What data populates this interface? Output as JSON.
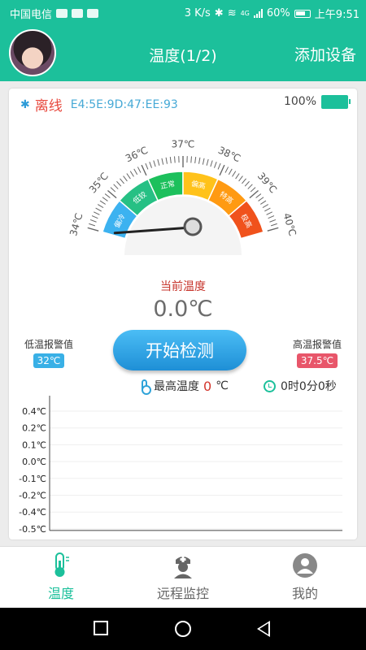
{
  "status_bar": {
    "carrier": "中国电信",
    "speed": "3 K/s",
    "network": "4G",
    "battery": "60%",
    "time": "上午9:51"
  },
  "header": {
    "title": "温度(1/2)",
    "add_device": "添加设备"
  },
  "device": {
    "status": "离线",
    "mac": "E4:5E:9D:47:EE:93",
    "battery_pct": "100%",
    "battery_level": 1.0
  },
  "gauge": {
    "ticks": [
      "34℃",
      "35℃",
      "36℃",
      "37℃",
      "38℃",
      "39℃",
      "40℃"
    ],
    "zones": [
      {
        "label": "偏冷",
        "color": "#3cb2f0"
      },
      {
        "label": "低较",
        "color": "#26c084"
      },
      {
        "label": "正常",
        "color": "#1cc05c"
      },
      {
        "label": "偏高",
        "color": "#ffc21a"
      },
      {
        "label": "特高",
        "color": "#ff9a12"
      },
      {
        "label": "极高",
        "color": "#f0521c"
      }
    ],
    "current_label": "当前温度",
    "current_value": "0.0℃"
  },
  "alarms": {
    "low_label": "低温报警值",
    "low_value": "32℃",
    "high_label": "高温报警值",
    "high_value": "37.5℃"
  },
  "controls": {
    "start_button": "开始检测",
    "max_temp_label": "最高温度",
    "max_temp_value": "0",
    "max_temp_unit": "℃",
    "elapsed": "0时0分0秒"
  },
  "chart_data": {
    "type": "line",
    "title": "",
    "xlabel": "",
    "ylabel": "",
    "y_ticks": [
      "0.4℃",
      "0.2℃",
      "0.1℃",
      "0.0℃",
      "-0.1℃",
      "-0.2℃",
      "-0.4℃",
      "-0.5℃"
    ],
    "series": [],
    "grid": true
  },
  "bottom_nav": {
    "items": [
      {
        "label": "温度",
        "active": true
      },
      {
        "label": "远程监控",
        "active": false
      },
      {
        "label": "我的",
        "active": false
      }
    ]
  }
}
